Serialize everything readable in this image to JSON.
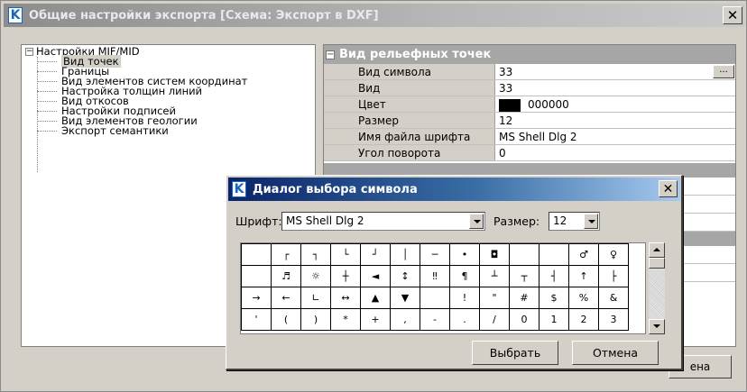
{
  "main_window": {
    "title": "Общие настройки экспорта [Схема: Экспорт в DXF]",
    "app_icon_glyph": "K",
    "close_glyph": "✕"
  },
  "tree": {
    "root_label": "Настройки MIF/MID",
    "root_expander": "−",
    "items": [
      {
        "label": "Вид точек",
        "selected": true
      },
      {
        "label": "Границы"
      },
      {
        "label": "Вид элементов систем координат"
      },
      {
        "label": "Настройка толщин линий"
      },
      {
        "label": "Вид откосов"
      },
      {
        "label": "Настройки подписей"
      },
      {
        "label": "Вид элементов геологии"
      },
      {
        "label": "Экспорт семантики"
      }
    ]
  },
  "properties": {
    "category_label": "Вид рельефных точек",
    "category_toggle": "−",
    "rows": [
      {
        "name": "Вид символа",
        "value": "33",
        "button": "..."
      },
      {
        "name": "Вид",
        "value": "33"
      },
      {
        "name": "Цвет",
        "value": "000000",
        "swatch_color": "#000000"
      },
      {
        "name": "Размер",
        "value": "12"
      },
      {
        "name": "Имя файла шрифта",
        "value": "MS Shell Dlg 2"
      },
      {
        "name": "Угол поворота",
        "value": "0"
      }
    ]
  },
  "background_button": {
    "label": "ена"
  },
  "dialog": {
    "title": "Диалог выбора символа",
    "app_icon_glyph": "K",
    "close_glyph": "✕",
    "font_label": "Шрифт:",
    "font_value": "MS Shell Dlg 2",
    "size_label": "Размер:",
    "size_value": "12",
    "symbol_rows": [
      [
        "",
        "┌",
        "┐",
        "└",
        "┘",
        "│",
        "─",
        "•",
        "◘",
        "",
        "",
        "♂",
        "♀"
      ],
      [
        "",
        "♬",
        "☼",
        "┼",
        "◄",
        "↕",
        "‼",
        "¶",
        "┴",
        "┬",
        "┤",
        "↑",
        "├"
      ],
      [
        "→",
        "←",
        "∟",
        "↔",
        "▲",
        "▼",
        "",
        "!",
        "\"",
        "#",
        "$",
        "%",
        "&"
      ],
      [
        "'",
        "(",
        ")",
        "*",
        "+",
        ",",
        "-",
        ".",
        "/",
        "0",
        "1",
        "2",
        "3"
      ]
    ],
    "select_button": "Выбрать",
    "cancel_button": "Отмена"
  }
}
